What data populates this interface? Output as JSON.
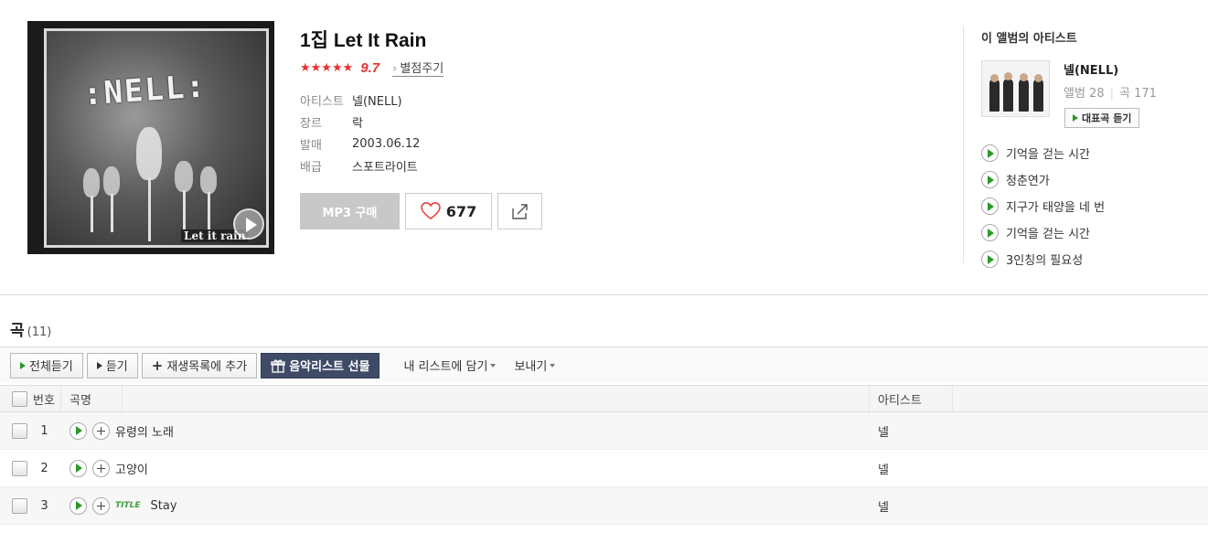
{
  "album": {
    "title": "1집 Let It Rain",
    "stars": "★★★★★",
    "score": "9.7",
    "rate_link": "별점주기",
    "info": [
      {
        "label": "아티스트",
        "value": "넬(NELL)"
      },
      {
        "label": "장르",
        "value": "락"
      },
      {
        "label": "발매",
        "value": "2003.06.12"
      },
      {
        "label": "배급",
        "value": "스포트라이트"
      }
    ],
    "cover": {
      "logo": ":NELL:",
      "caption": "Let it rain"
    },
    "buttons": {
      "mp3": "MP3 구매",
      "likes": "677"
    }
  },
  "artist_panel": {
    "heading": "이 앨범의 아티스트",
    "name": "넬(NELL)",
    "albums": "앨범 28",
    "songs": "곡 171",
    "rep_button": "대표곡 듣기",
    "rep_songs": [
      "기억을 걷는 시간",
      "청춘연가",
      "지구가 태양을 네 번",
      "기억을 걷는 시간",
      "3인칭의 필요성"
    ]
  },
  "songs_section": {
    "title": "곡",
    "count": "(11)",
    "toolbar": {
      "play_all": "전체듣기",
      "play": "듣기",
      "add_playlist": "재생목록에 추가",
      "gift": "음악리스트 선물",
      "save_list": "내 리스트에 담기",
      "send": "보내기"
    },
    "columns": {
      "num": "번호",
      "title": "곡명",
      "artist": "아티스트"
    },
    "rows": [
      {
        "num": "1",
        "title": "유령의 노래",
        "title_badge": "",
        "artist": "넬"
      },
      {
        "num": "2",
        "title": "고양이",
        "title_badge": "",
        "artist": "넬"
      },
      {
        "num": "3",
        "title": "Stay",
        "title_badge": "TITLE",
        "artist": "넬"
      }
    ]
  },
  "colors": {
    "accent_red": "#e8322c",
    "play_green": "#2a9a2a",
    "gift_button": "#3e4a66"
  }
}
